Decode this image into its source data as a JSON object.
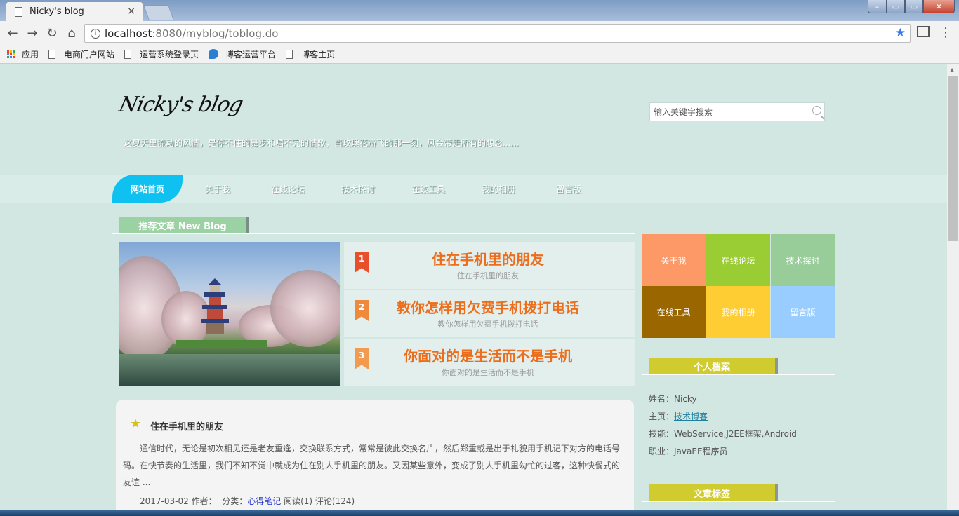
{
  "browser": {
    "tab_title": "Nicky's blog",
    "tab_close": "×",
    "url_host": "localhost",
    "url_path": ":8080/myblog/toblog.do",
    "window_min": "–",
    "window_restore": "▭",
    "window_close": "✕",
    "nav_back": "←",
    "nav_forward": "→",
    "nav_reload": "↻",
    "nav_home": "⌂",
    "star": "★",
    "menu": "⋮",
    "bookmarks": [
      "应用",
      "电商门户网站",
      "运营系统登录页",
      "博客运营平台",
      "博客主页"
    ]
  },
  "header": {
    "logo": "Nicky's blog",
    "tagline": "这夏天里流动的风情，是停不住的舞步和唱不完的情歌，当玫瑰花瓣飞的那一刻，风会带走所有的想念......",
    "search_placeholder": "输入关键字搜索"
  },
  "nav": {
    "items": [
      "网站首页",
      "关于我",
      "在线论坛",
      "技术探讨",
      "在线工具",
      "我的相册",
      "留言版"
    ]
  },
  "recommend": {
    "title": "推荐文章 New Blog",
    "items": [
      {
        "num": "1",
        "title": "住在手机里的朋友",
        "subtitle": "住在手机里的朋友",
        "color": "#e7502a"
      },
      {
        "num": "2",
        "title": "教你怎样用欠费手机拨打电话",
        "subtitle": "教你怎样用欠费手机拨打电话",
        "color": "#ef8a3c"
      },
      {
        "num": "3",
        "title": "你面对的是生活而不是手机",
        "subtitle": "你面对的是生活而不是手机",
        "color": "#f29a4e"
      }
    ]
  },
  "article": {
    "title": "住在手机里的朋友",
    "body": "通信时代，无论是初次相见还是老友重逢，交换联系方式，常常是彼此交换名片，然后郑重或是出于礼貌用手机记下对方的电话号码。在快节奏的生活里，我们不知不觉中就成为住在别人手机里的朋友。又因某些意外，变成了别人手机里匆忙的过客，这种快餐式的友谊 ...",
    "date": "2017-03-02",
    "author_label": "作者：",
    "category_label": "分类：",
    "category": "心得笔记",
    "reads": "阅读(1)",
    "comments": "评论(124)"
  },
  "tiles": [
    {
      "label": "关于我",
      "color": "#fd9966"
    },
    {
      "label": "在线论坛",
      "color": "#9acc34"
    },
    {
      "label": "技术探讨",
      "color": "#98cc99"
    },
    {
      "label": "在线工具",
      "color": "#996600"
    },
    {
      "label": "我的相册",
      "color": "#fecc33"
    },
    {
      "label": "留言版",
      "color": "#99ccff"
    }
  ],
  "profile": {
    "heading": "个人档案",
    "name_label": "姓名：",
    "name": "Nicky",
    "home_label": "主页：",
    "home_link": "技术博客",
    "skills_label": "技能：",
    "skills": "WebService,J2EE框架,Android",
    "job_label": "职业：",
    "job": "JavaEE程序员"
  },
  "tags": {
    "heading": "文章标签"
  }
}
